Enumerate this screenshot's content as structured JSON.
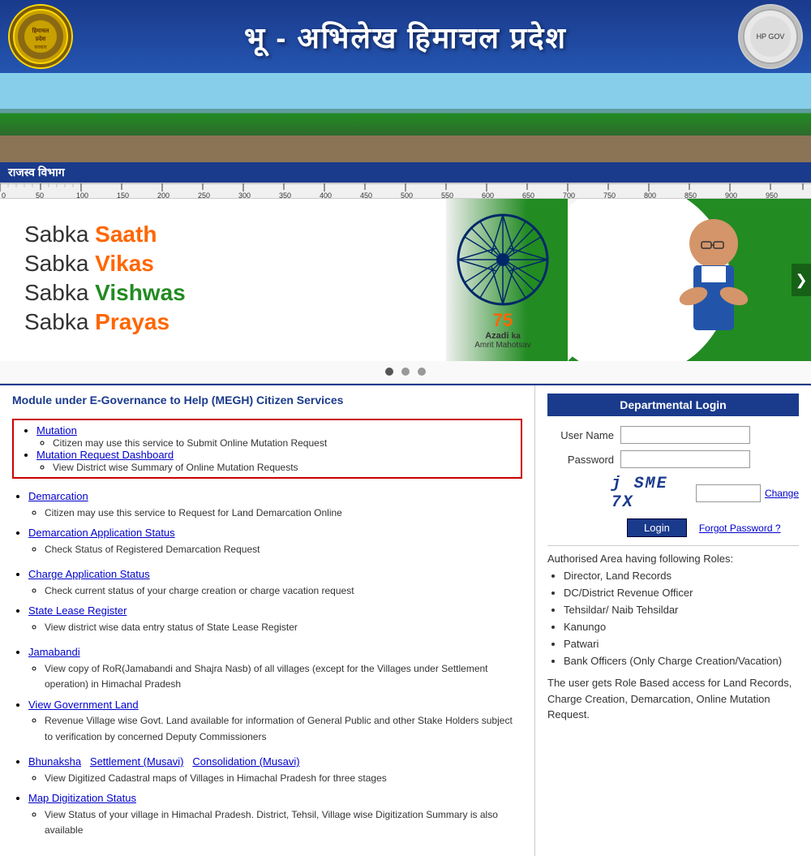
{
  "header": {
    "title": "भू - अभिलेख हिमाचल प्रदेश",
    "dept_label": "राजस्व विभाग",
    "logo_left_text": "हिमाचल\nप्रदेश\nसरकार",
    "logo_right_text": "HP\nGovt"
  },
  "azadi_banner": {
    "line1_plain": "Sabka ",
    "line1_orange": "Saath",
    "line2_plain": "Sabka ",
    "line2_orange": "Vikas",
    "line3_plain": "Sabka ",
    "line3_green": "Vishwas",
    "line4_plain": "Sabka ",
    "line4_orange": "Prayas",
    "azadi_75": "75",
    "azadi_title": "Azadi",
    "azadi_sub1": "ka",
    "azadi_sub2": "Amrit Mahotsav",
    "next_button": "❯"
  },
  "services_panel": {
    "heading": "Module under E-Governance to Help (MEGH) Citizen Services",
    "highlighted_services": [
      {
        "name": "Mutation",
        "desc": "Citizen may use this service to Submit Online Mutation Request"
      },
      {
        "name": "Mutation Request Dashboard",
        "desc": "View District wise Summary of Online Mutation Requests"
      }
    ],
    "demarcation_services": [
      {
        "name": "Demarcation",
        "desc": "Citizen may use this service to Request for Land Demarcation Online"
      },
      {
        "name": "Demarcation Application Status",
        "desc": "Check Status of Registered Demarcation Request"
      }
    ],
    "charge_services": [
      {
        "name": "Charge Application Status",
        "desc": "Check current status of your charge creation or charge vacation request"
      },
      {
        "name": "State Lease Register",
        "desc": "View district wise data entry status of State Lease Register"
      }
    ],
    "other_services": [
      {
        "name": "Jamabandi",
        "desc": "View copy of RoR(Jamabandi and Shajra Nasb) of all villages (except for the Villages under Settlement operation) in Himachal Pradesh"
      },
      {
        "name": "View Government Land",
        "desc": "Revenue Village wise Govt. Land available for information of General Public and other Stake Holders subject to verification by concerned Deputy Commissioners"
      }
    ],
    "bhu_services": [
      {
        "name1": "Bhunaksha",
        "name2": "Settlement (Musavi)",
        "name3": "Consolidation (Musavi)",
        "desc": "View Digitized Cadastral maps of Villages in Himachal Pradesh for three stages"
      },
      {
        "name": "Map Digitization Status",
        "desc": "View Status of your village in Himachal Pradesh. District, Tehsil, Village wise Digitization Summary is also available"
      }
    ]
  },
  "login_panel": {
    "title": "Departmental Login",
    "username_label": "User Name",
    "password_label": "Password",
    "captcha_text": "j SME 7X",
    "captcha_input_placeholder": "",
    "change_label": "Change",
    "login_button": "Login",
    "forgot_label": "Forgot Password ?",
    "auth_heading": "Authorised Area having following Roles:",
    "roles": [
      "Director, Land Records",
      "DC/District Revenue Officer",
      "Tehsildar/ Naib Tehsildar",
      "Kanungo",
      "Patwari",
      "Bank Officers (Only Charge Creation/Vacation)"
    ],
    "role_desc": "The user gets Role Based access for Land Records, Charge Creation, Demarcation, Online Mutation Request."
  }
}
